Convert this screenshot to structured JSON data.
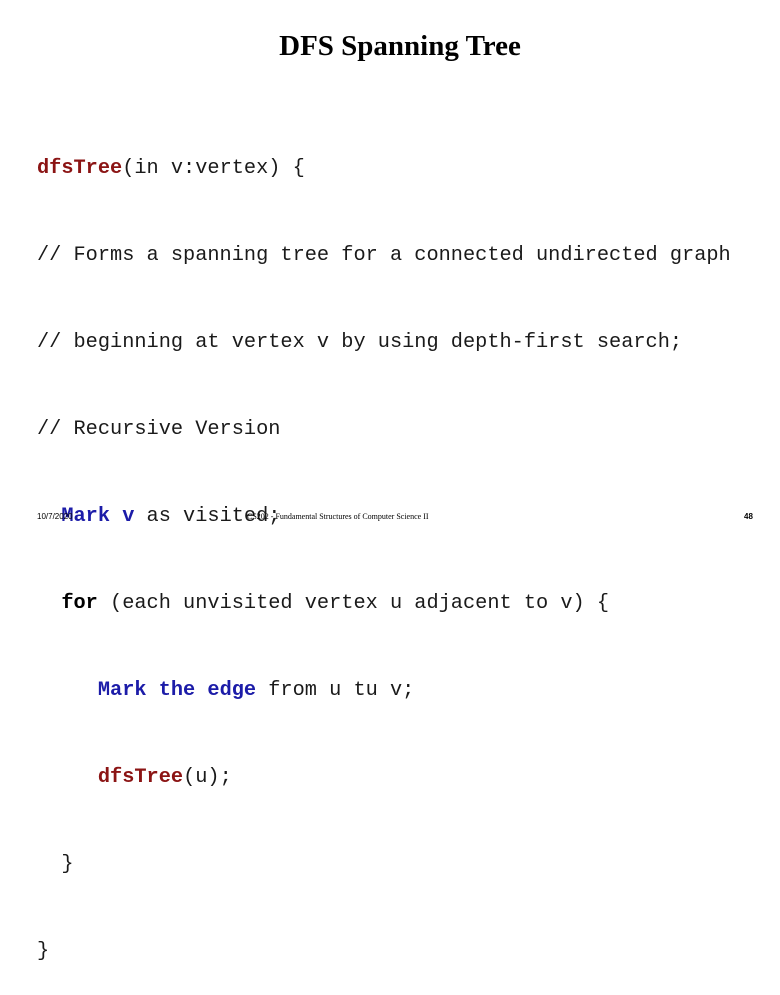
{
  "slide": {
    "title": "DFS Spanning Tree",
    "colors": {
      "function_name": "#8b1414",
      "highlight_blue": "#1c1ca8",
      "text": "#1a1a1a"
    },
    "code": {
      "l1_fn": "dfsTree",
      "l1_rest": "(in v:vertex) {",
      "l2": "// Forms a spanning tree for a connected undirected graph",
      "l3": "// beginning at vertex v by using depth-first search;",
      "l4": "// Recursive Version",
      "l5_indent": "  ",
      "l5_bold": "Mark v",
      "l5_rest": " as visited;",
      "l6_indent": "  ",
      "l6_kw": "for",
      "l6_rest": " (each unvisited vertex u adjacent to v) {",
      "l7_indent": "     ",
      "l7_bold": "Mark the edge",
      "l7_rest": " from u tu v;",
      "l8_indent": "     ",
      "l8_fn": "dfsTree",
      "l8_rest": "(u);",
      "l9": "  }",
      "l10": "}"
    },
    "footer": {
      "date": "10/7/2020",
      "course": "CS202 - Fundamental Structures of Computer Science II",
      "page": "48"
    }
  }
}
